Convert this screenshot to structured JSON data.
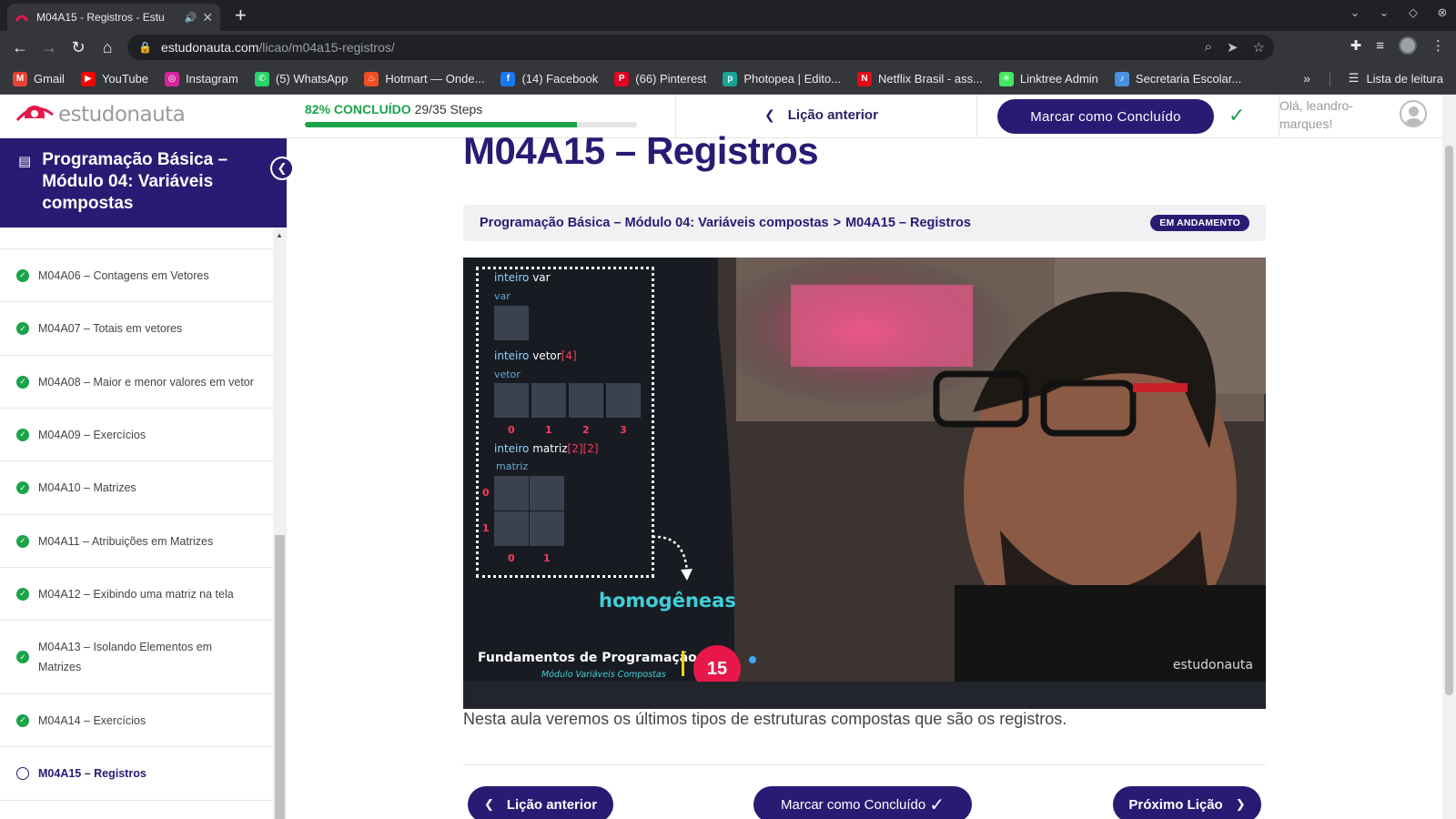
{
  "browser": {
    "tab_title": "M04A15 - Registros - Estu",
    "url_host": "estudonauta.com",
    "url_path": "/licao/m04a15-registros/",
    "bookmarks": [
      {
        "label": "Gmail",
        "color": "#ea4335",
        "glyph": "M"
      },
      {
        "label": "YouTube",
        "color": "#ff0000",
        "glyph": "▶"
      },
      {
        "label": "Instagram",
        "color": "#d6249f",
        "glyph": "◎"
      },
      {
        "label": "(5) WhatsApp",
        "color": "#25d366",
        "glyph": "✆"
      },
      {
        "label": "Hotmart — Onde...",
        "color": "#f04e23",
        "glyph": "♨"
      },
      {
        "label": "(14) Facebook",
        "color": "#1877f2",
        "glyph": "f"
      },
      {
        "label": "(66) Pinterest",
        "color": "#e60023",
        "glyph": "P"
      },
      {
        "label": "Photopea | Edito...",
        "color": "#18a497",
        "glyph": "p"
      },
      {
        "label": "Netflix Brasil - ass...",
        "color": "#e50914",
        "glyph": "N"
      },
      {
        "label": "Linktree Admin",
        "color": "#43e660",
        "glyph": "✳"
      },
      {
        "label": "Secretaria Escolar...",
        "color": "#4a90e2",
        "glyph": "♪"
      }
    ],
    "reading_list": "Lista de leitura"
  },
  "header": {
    "logo_text": "estudonauta",
    "progress_pct_label": "82% CONCLUÍDO",
    "progress_steps": "29/35 Steps",
    "progress_value": 0.82,
    "prev_label": "Lição anterior",
    "complete_label": "Marcar como Concluído",
    "greeting": "Olá, leandro-marques!"
  },
  "sidebar": {
    "course_title": "Programação Básica – Módulo 04: Variáveis compostas",
    "lessons": [
      {
        "label": "M04A06 – Contagens em Vetores",
        "done": true
      },
      {
        "label": "M04A07 – Totais em vetores",
        "done": true
      },
      {
        "label": "M04A08 – Maior e menor valores em vetor",
        "done": true
      },
      {
        "label": "M04A09 – Exercícios",
        "done": true
      },
      {
        "label": "M04A10 – Matrizes",
        "done": true
      },
      {
        "label": "M04A11 – Atribuições em Matrizes",
        "done": true
      },
      {
        "label": "M04A12 – Exibindo uma matriz na tela",
        "done": true
      },
      {
        "label": "M04A13 – Isolando Elementos em Matrizes",
        "done": true
      },
      {
        "label": "M04A14 – Exercícios",
        "done": true
      },
      {
        "label": "M04A15 – Registros",
        "done": false
      }
    ]
  },
  "main": {
    "title": "M04A15 – Registros",
    "breadcrumb_course": "Programação Básica – Módulo 04: Variáveis compostas",
    "breadcrumb_sep": ">",
    "breadcrumb_lesson": "M04A15 – Registros",
    "status_badge": "EM ANDAMENTO",
    "description": "Nesta aula veremos os últimos tipos de estruturas compostas que são os registros.",
    "bottom_prev": "Lição anterior",
    "bottom_complete": "Marcar como Concluído",
    "bottom_next": "Próximo Lição"
  },
  "video": {
    "kw": "inteiro",
    "var_name": "var",
    "vetor_name": "vetor",
    "vetor_dim": "[4]",
    "matriz_name": "matriz",
    "matriz_dim": "[2][2]",
    "label_var": "var",
    "label_vetor": "vetor",
    "label_matriz": "matriz",
    "vetor_idx": [
      "0",
      "1",
      "2",
      "3"
    ],
    "matriz_row_idx": [
      "0",
      "1"
    ],
    "matriz_col_idx": [
      "0",
      "1"
    ],
    "homogeneas": "homogêneas",
    "series_title": "Fundamentos de Programação",
    "series_sub": "Módulo Variáveis Compostas",
    "episode": "15",
    "watermark": "estudonauta"
  }
}
